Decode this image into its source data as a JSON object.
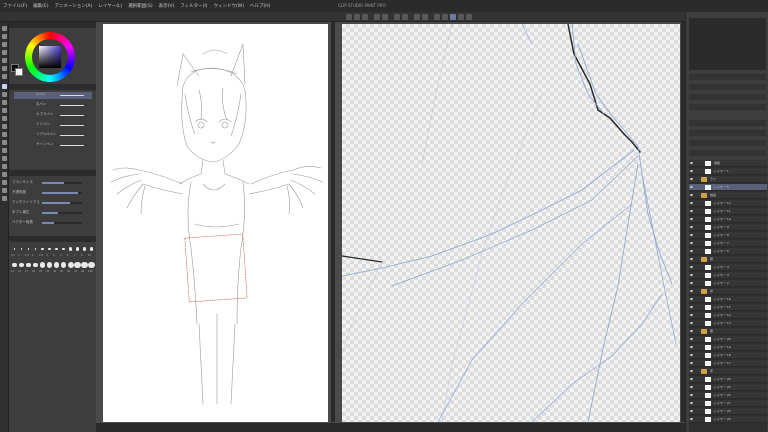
{
  "menu": {
    "items": [
      "ファイル(F)",
      "編集(E)",
      "アニメーション(A)",
      "レイヤー(L)",
      "選択範囲(S)",
      "表示(V)",
      "フィルター(I)",
      "ウィンドウ(W)",
      "ヘルプ(H)"
    ],
    "window_title": "CLIP STUDIO PAINT PRO"
  },
  "color_panel": {
    "main_color": "#111111",
    "sub_color": "#ffffff",
    "hue_color": "#4b3bd1"
  },
  "sub_tool": {
    "items": [
      {
        "label": "Gペン"
      },
      {
        "label": "丸ペン"
      },
      {
        "label": "カブラペン"
      },
      {
        "label": "ミリペン"
      },
      {
        "label": "リアルGペン"
      },
      {
        "label": "サインペン"
      }
    ]
  },
  "tool_property": {
    "rows": [
      {
        "label": "ブラシサイズ",
        "value": 0.55
      },
      {
        "label": "不透明度",
        "value": 0.9
      },
      {
        "label": "アンチエイリアス",
        "value": 0.7
      },
      {
        "label": "手ブレ補正",
        "value": 0.4
      },
      {
        "label": "ベクター吸着",
        "value": 0.3
      }
    ]
  },
  "brush_sizes": [
    "0.7",
    "1",
    "1.5",
    "2",
    "2.5",
    "3",
    "4",
    "5",
    "6",
    "7",
    "8",
    "10",
    "12",
    "15",
    "17",
    "20",
    "25",
    "30",
    "40",
    "50",
    "60",
    "70",
    "80",
    "100"
  ],
  "layers": {
    "items": [
      {
        "name": "用紙",
        "type": "layer"
      },
      {
        "name": "レイヤー 1",
        "type": "layer"
      },
      {
        "name": "ラフ",
        "type": "folder"
      },
      {
        "name": "レイヤー 5",
        "type": "layer",
        "selected": true
      },
      {
        "name": "線画",
        "type": "folder"
      },
      {
        "name": "レイヤー 12",
        "type": "layer"
      },
      {
        "name": "レイヤー 11",
        "type": "layer"
      },
      {
        "name": "レイヤー 10",
        "type": "layer"
      },
      {
        "name": "レイヤー 9",
        "type": "layer"
      },
      {
        "name": "レイヤー 8",
        "type": "layer"
      },
      {
        "name": "レイヤー 7",
        "type": "layer"
      },
      {
        "name": "レイヤー 6",
        "type": "layer"
      },
      {
        "name": "顔",
        "type": "folder"
      },
      {
        "name": "レイヤー 4",
        "type": "layer"
      },
      {
        "name": "レイヤー 3",
        "type": "layer"
      },
      {
        "name": "レイヤー 2",
        "type": "layer"
      },
      {
        "name": "髪",
        "type": "folder"
      },
      {
        "name": "レイヤー 16",
        "type": "layer"
      },
      {
        "name": "レイヤー 15",
        "type": "layer"
      },
      {
        "name": "レイヤー 14",
        "type": "layer"
      },
      {
        "name": "レイヤー 13",
        "type": "layer"
      },
      {
        "name": "服",
        "type": "folder"
      },
      {
        "name": "レイヤー 20",
        "type": "layer"
      },
      {
        "name": "レイヤー 19",
        "type": "layer"
      },
      {
        "name": "レイヤー 18",
        "type": "layer"
      },
      {
        "name": "レイヤー 17",
        "type": "layer"
      },
      {
        "name": "手",
        "type": "folder"
      },
      {
        "name": "レイヤー 24",
        "type": "layer"
      },
      {
        "name": "レイヤー 23",
        "type": "layer"
      },
      {
        "name": "レイヤー 22",
        "type": "layer"
      },
      {
        "name": "レイヤー 21",
        "type": "layer"
      },
      {
        "name": "レイヤー 25",
        "type": "layer"
      },
      {
        "name": "レイヤー 26",
        "type": "layer"
      }
    ]
  }
}
